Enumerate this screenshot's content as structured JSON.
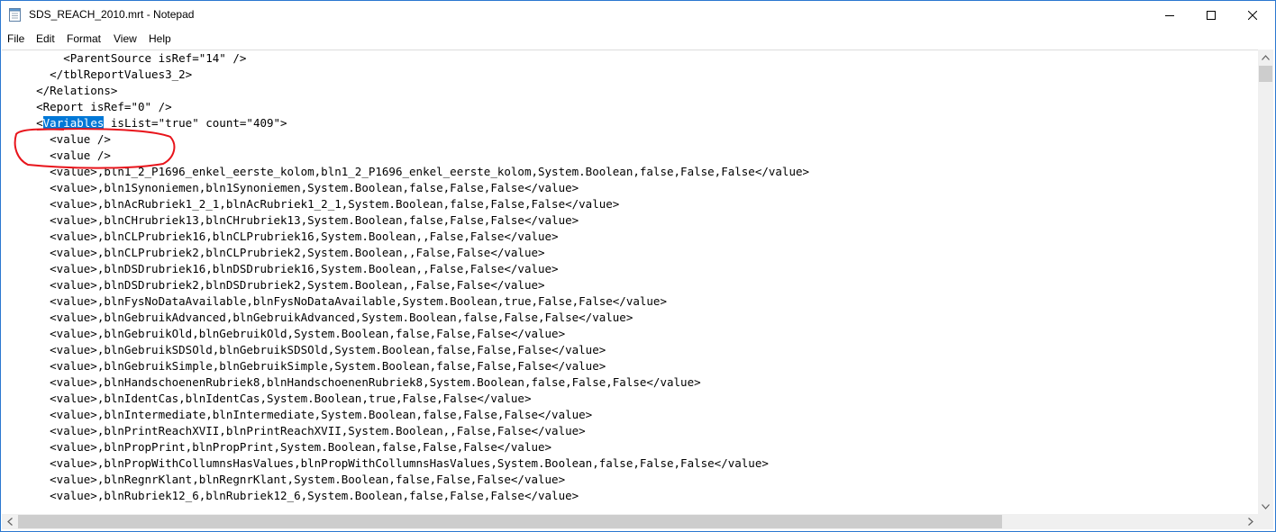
{
  "window": {
    "title": "SDS_REACH_2010.mrt - Notepad",
    "accent_color": "#0078d7",
    "annotation_color": "#e8141b"
  },
  "menu": [
    "File",
    "Edit",
    "Format",
    "View",
    "Help"
  ],
  "selection_text": "Variables",
  "lines": [
    "        <ParentSource isRef=\"14\" />",
    "      </tblReportValues3_2>",
    "    </Relations>",
    "    <Report isRef=\"0\" />",
    "    <Variables isList=\"true\" count=\"409\">",
    "      <value />",
    "      <value />",
    "      <value>,bln1_2_P1696_enkel_eerste_kolom,bln1_2_P1696_enkel_eerste_kolom,System.Boolean,false,False,False</value>",
    "      <value>,bln1Synoniemen,bln1Synoniemen,System.Boolean,false,False,False</value>",
    "      <value>,blnAcRubriek1_2_1,blnAcRubriek1_2_1,System.Boolean,false,False,False</value>",
    "      <value>,blnCHrubriek13,blnCHrubriek13,System.Boolean,false,False,False</value>",
    "      <value>,blnCLPrubriek16,blnCLPrubriek16,System.Boolean,,False,False</value>",
    "      <value>,blnCLPrubriek2,blnCLPrubriek2,System.Boolean,,False,False</value>",
    "      <value>,blnDSDrubriek16,blnDSDrubriek16,System.Boolean,,False,False</value>",
    "      <value>,blnDSDrubriek2,blnDSDrubriek2,System.Boolean,,False,False</value>",
    "      <value>,blnFysNoDataAvailable,blnFysNoDataAvailable,System.Boolean,true,False,False</value>",
    "      <value>,blnGebruikAdvanced,blnGebruikAdvanced,System.Boolean,false,False,False</value>",
    "      <value>,blnGebruikOld,blnGebruikOld,System.Boolean,false,False,False</value>",
    "      <value>,blnGebruikSDSOld,blnGebruikSDSOld,System.Boolean,false,False,False</value>",
    "      <value>,blnGebruikSimple,blnGebruikSimple,System.Boolean,false,False,False</value>",
    "      <value>,blnHandschoenenRubriek8,blnHandschoenenRubriek8,System.Boolean,false,False,False</value>",
    "      <value>,blnIdentCas,blnIdentCas,System.Boolean,true,False,False</value>",
    "      <value>,blnIntermediate,blnIntermediate,System.Boolean,false,False,False</value>",
    "      <value>,blnPrintReachXVII,blnPrintReachXVII,System.Boolean,,False,False</value>",
    "      <value>,blnPropPrint,blnPropPrint,System.Boolean,false,False,False</value>",
    "      <value>,blnPropWithCollumnsHasValues,blnPropWithCollumnsHasValues,System.Boolean,false,False,False</value>",
    "      <value>,blnRegnrKlant,blnRegnrKlant,System.Boolean,false,False,False</value>",
    "      <value>,blnRubriek12_6,blnRubriek12_6,System.Boolean,false,False,False</value>"
  ]
}
